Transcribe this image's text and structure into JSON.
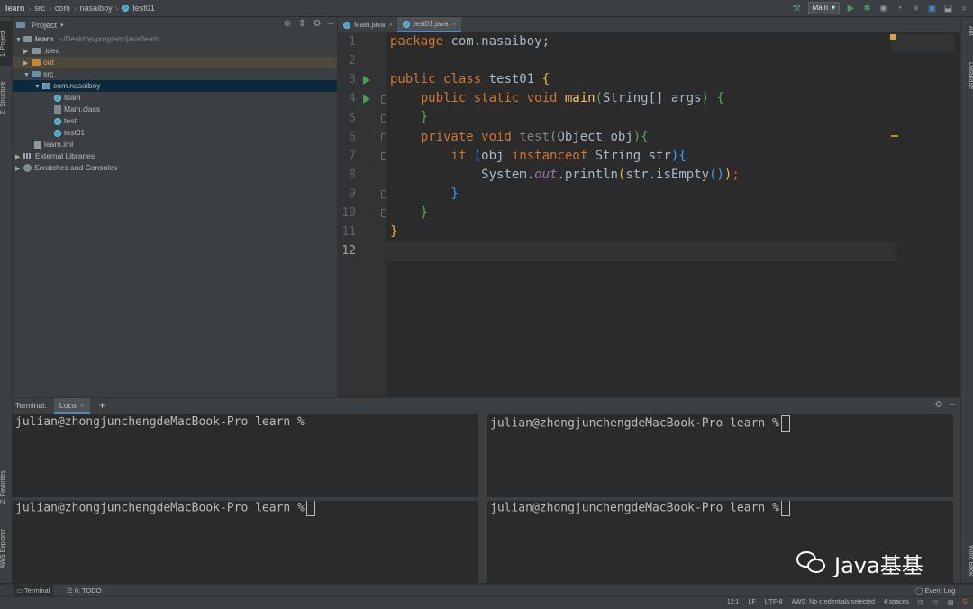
{
  "navbar": {
    "crumbs": [
      "learn",
      "src",
      "com",
      "nasaiboy",
      "test01"
    ],
    "run_config": "Main"
  },
  "left_strip": [
    "1: Project",
    "Z: Structure",
    "2: Favorites",
    "AWS Explorer"
  ],
  "right_strip": [
    "Ant",
    "Database",
    "Word Book"
  ],
  "project_panel": {
    "title": "Project",
    "tree": [
      {
        "label": "learn",
        "note": "~/Desktop/program/java/learn"
      },
      {
        "label": ".idea"
      },
      {
        "label": "out"
      },
      {
        "label": "src"
      },
      {
        "label": "com.nasaiboy"
      },
      {
        "label": "Main"
      },
      {
        "label": "Main.class"
      },
      {
        "label": "test"
      },
      {
        "label": "test01"
      },
      {
        "label": "learn.iml"
      },
      {
        "label": "External Libraries"
      },
      {
        "label": "Scratches and Consoles"
      }
    ]
  },
  "editor": {
    "tabs": [
      {
        "label": "Main.java"
      },
      {
        "label": "test01.java"
      }
    ],
    "line_numbers": [
      "1",
      "2",
      "3",
      "4",
      "5",
      "6",
      "7",
      "8",
      "9",
      "10",
      "11",
      "12"
    ],
    "current_line": "12",
    "code": {
      "l1a": "package",
      "l1b": " com.nasaiboy;",
      "l3a": "public class",
      "l3b": " test01 ",
      "l3c": "{",
      "l4a": "public static void",
      "l4b": "main",
      "l4c": "(",
      "l4d": "String[] args",
      "l4e": ")",
      "l4f": "{",
      "l5": "}",
      "l6a": "private void",
      "l6b": "test",
      "l6c": "(",
      "l6d": "Object obj",
      "l6e": ")",
      "l6f": "{",
      "l7a": "if",
      "l7b": "(",
      "l7c": "obj ",
      "l7d": "instanceof",
      "l7e": " String str",
      "l7f": ")",
      "l7g": "{",
      "l8a": "System.",
      "l8b": "out",
      "l8c": ".println",
      "l8d": "(",
      "l8e": "str.isEmpty",
      "l8f": "()",
      "l8g": ")",
      "l8h": ";",
      "l9": "}",
      "l10": "}",
      "l11": "}"
    }
  },
  "terminal": {
    "title": "Terminal:",
    "tab": "Local",
    "prompt": "julian@zhongjunchengdeMacBook-Pro learn %"
  },
  "bottom_tabs": [
    "Terminal",
    "6: TODO"
  ],
  "event_log": "Event Log",
  "status": {
    "position": "12:1",
    "line_sep": "LF",
    "encoding": "UTF-8",
    "aws": "AWS: No credentials selected",
    "indent": "4 spaces"
  },
  "watermark": "Java基基"
}
